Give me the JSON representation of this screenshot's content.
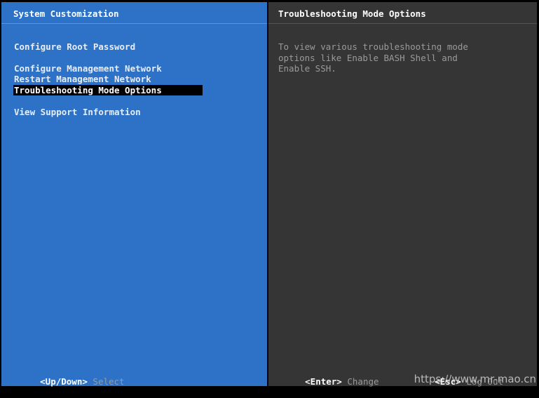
{
  "left_pane": {
    "title": "System Customization",
    "menu_items": [
      {
        "label": "Configure Root Password",
        "selected": false
      },
      {
        "label": "Configure Management Network",
        "selected": false
      },
      {
        "label": "Restart Management Network",
        "selected": false
      },
      {
        "label": "Troubleshooting Mode Options",
        "selected": true
      },
      {
        "label": "View Support Information",
        "selected": false
      }
    ],
    "footer": {
      "key": "<Up/Down>",
      "action": "Select"
    }
  },
  "right_pane": {
    "title": "Troubleshooting Mode Options",
    "description": "To view various troubleshooting mode\noptions like Enable BASH Shell and\nEnable SSH.",
    "footer_enter": {
      "key": "<Enter>",
      "action": "Change"
    },
    "footer_esc": {
      "key": "<Esc>",
      "action": "Log Out"
    }
  },
  "colors": {
    "left_bg": "#2d72c6",
    "right_bg": "#353535",
    "selection_bg": "#000000"
  },
  "watermark": "https://www.mr-mao.cn"
}
